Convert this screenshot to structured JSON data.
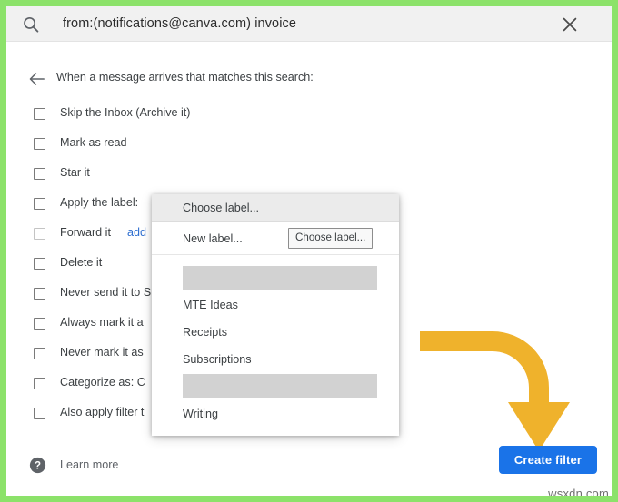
{
  "search": {
    "query": "from:(notifications@canva.com) invoice",
    "search_icon": "search-icon",
    "clear_icon": "close-icon"
  },
  "filter_panel": {
    "back_icon": "arrow-left-icon",
    "heading": "When a message arrives that matches this search:",
    "options": [
      {
        "label": "Skip the Inbox (Archive it)",
        "checked": false,
        "disabled": false
      },
      {
        "label": "Mark as read",
        "checked": false,
        "disabled": false
      },
      {
        "label": "Star it",
        "checked": false,
        "disabled": false
      },
      {
        "label": "Apply the label:",
        "checked": false,
        "disabled": false
      },
      {
        "label": "Forward it",
        "checked": false,
        "disabled": true,
        "link": "add"
      },
      {
        "label": "Delete it",
        "checked": false,
        "disabled": false
      },
      {
        "label": "Never send it to S",
        "checked": false,
        "disabled": false
      },
      {
        "label": "Always mark it a",
        "checked": false,
        "disabled": false
      },
      {
        "label": "Never mark it as",
        "checked": false,
        "disabled": false
      },
      {
        "label": "Categorize as:  C",
        "checked": false,
        "disabled": false
      },
      {
        "label": "Also apply filter t",
        "checked": false,
        "disabled": false
      }
    ],
    "learn_more": {
      "label": "Learn more",
      "icon": "help-circle-icon"
    },
    "create_filter_label": "Create filter"
  },
  "label_dropdown": {
    "header_item": "Choose label...",
    "new_label_item": "New label...",
    "choose_label_button": "Choose label...",
    "items": [
      {
        "label": "",
        "redacted": true
      },
      {
        "label": "MTE Ideas",
        "redacted": false
      },
      {
        "label": "Receipts",
        "redacted": false
      },
      {
        "label": "Subscriptions",
        "redacted": false
      },
      {
        "label": "",
        "redacted": true
      },
      {
        "label": "Writing",
        "redacted": false
      }
    ]
  },
  "annotation": {
    "arrow_name": "curved-arrow-annotation",
    "arrow_color": "#EFB22C"
  },
  "watermark": {
    "text": "wsxdn.com"
  },
  "colors": {
    "frame_green": "#8ce26a",
    "button_blue": "#1a73e8",
    "arrow_amber": "#EFB22C",
    "searchbar_gray": "#f1f1f1"
  }
}
